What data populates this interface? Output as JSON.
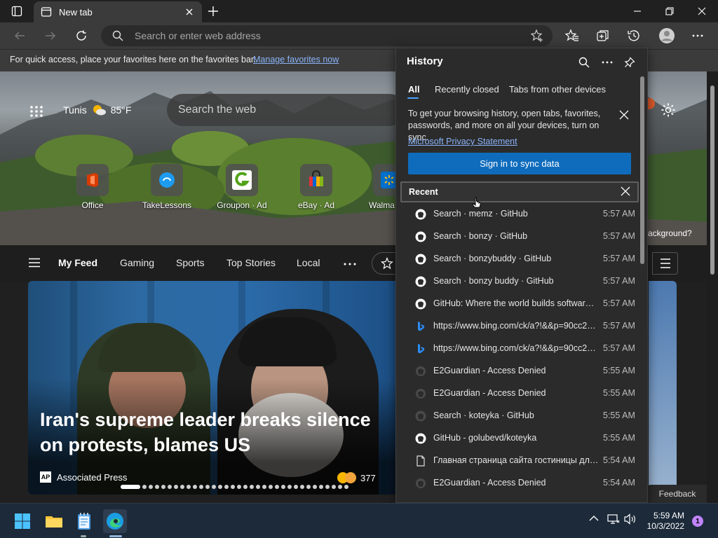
{
  "browser": {
    "tab_title": "New tab",
    "address_placeholder": "Search or enter web address"
  },
  "favorites_bar": {
    "message": "For quick access, place your favorites here on the favorites bar.",
    "link": "Manage favorites now"
  },
  "newtab": {
    "weather_city": "Tunis",
    "weather_temp": "85°F",
    "search_placeholder": "Search the web",
    "quick_links": [
      "Office",
      "TakeLessons",
      "Groupon · Ad",
      "eBay · Ad",
      "Walma"
    ],
    "background_question": "ackground?",
    "feed_tabs": [
      "My Feed",
      "Gaming",
      "Sports",
      "Top Stories",
      "Local"
    ],
    "article": {
      "headline": "Iran's supreme leader breaks silence on protests, blames US",
      "source": "Associated Press",
      "source_logo": "AP",
      "reactions": "377"
    },
    "feedback": "Feedback"
  },
  "history": {
    "title": "History",
    "tabs": [
      "All",
      "Recently closed",
      "Tabs from other devices"
    ],
    "sync_message": "To get your browsing history, open tabs, favorites, passwords, and more on all your devices, turn on sync.",
    "privacy_link": "Microsoft Privacy Statement",
    "signin_button": "Sign in to sync data",
    "recent_label": "Recent",
    "items": [
      {
        "icon": "github-icon",
        "title": "Search · memz · GitHub",
        "time": "5:57 AM"
      },
      {
        "icon": "github-icon",
        "title": "Search · bonzy · GitHub",
        "time": "5:57 AM"
      },
      {
        "icon": "github-icon",
        "title": "Search · bonzybuddy · GitHub",
        "time": "5:57 AM"
      },
      {
        "icon": "github-icon",
        "title": "Search · bonzy buddy · GitHub",
        "time": "5:57 AM"
      },
      {
        "icon": "github-icon",
        "title": "GitHub: Where the world builds software · GitHub",
        "time": "5:57 AM"
      },
      {
        "icon": "bing-icon",
        "title": "https://www.bing.com/ck/a?!&&p=90cc22...",
        "time": "5:57 AM"
      },
      {
        "icon": "bing-icon",
        "title": "https://www.bing.com/ck/a?!&&p=90cc22...",
        "time": "5:57 AM"
      },
      {
        "icon": "globe-icon",
        "title": "E2Guardian - Access Denied",
        "time": "5:55 AM"
      },
      {
        "icon": "globe-icon",
        "title": "E2Guardian - Access Denied",
        "time": "5:55 AM"
      },
      {
        "icon": "github-icon",
        "title": "Search · koteyka · GitHub",
        "time": "5:55 AM"
      },
      {
        "icon": "github-icon",
        "title": "GitHub - golubevd/koteyka",
        "time": "5:55 AM"
      },
      {
        "icon": "page-icon",
        "title": "Главная страница сайта гостиницы для к...",
        "time": "5:54 AM"
      },
      {
        "icon": "globe-icon",
        "title": "E2Guardian - Access Denied",
        "time": "5:54 AM"
      }
    ]
  },
  "taskbar": {
    "time": "5:59 AM",
    "date": "10/3/2022",
    "notification_count": "1"
  },
  "colors": {
    "accent_blue": "#0f6cbd",
    "link_blue": "#8ab4f8",
    "taskbar": "#1c2a3a"
  }
}
